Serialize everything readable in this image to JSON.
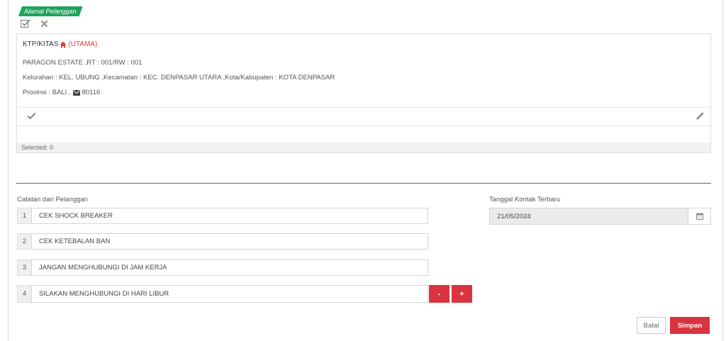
{
  "section": {
    "title": "Alamat Pelanggan"
  },
  "toolbar": {
    "confirm_icon": "check-square-icon",
    "remove_icon": "close-icon"
  },
  "address": {
    "type": "KTP/KITAS",
    "primary_label": "(UTAMA)",
    "street": "PARAGON ESTATE ,RT : 001/RW : 001",
    "region": "Kelurahan : KEL. UBUNG ,Kecamatan : KEC. DENPASAR UTARA ,Kota/Kabupaten : KOTA DENPASAR",
    "province": "Provinsi : BALI ,",
    "postal_code": "80116",
    "accent_color": "#e03a3a"
  },
  "selection": {
    "status": "Selected: 0"
  },
  "notes": {
    "label": "Catatan dari Pelanggan",
    "items": [
      {
        "num": "1",
        "value": "CEK SHOCK BREAKER"
      },
      {
        "num": "2",
        "value": "CEK KETEBALAN BAN"
      },
      {
        "num": "3",
        "value": "JANGAN MENGHUBUNGI DI JAM KERJA"
      },
      {
        "num": "4",
        "value": "SILAKAN MENGHUBUNGI DI HARI LIBUR"
      }
    ],
    "remove_label": "-",
    "add_label": "+"
  },
  "last_contact": {
    "label": "Tanggal Kontak Terbaru",
    "value": "21/05/2024"
  },
  "actions": {
    "cancel_label": "Batal",
    "save_label": "Simpan",
    "primary_color": "#d9333f"
  }
}
